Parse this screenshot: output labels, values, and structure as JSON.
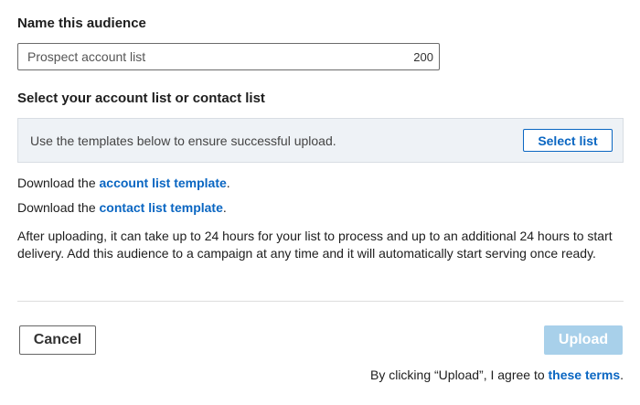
{
  "audience_name": {
    "label": "Name this audience",
    "value": "Prospect account list",
    "char_count": "200"
  },
  "list_selection": {
    "label": "Select your account list or contact list",
    "hint": "Use the templates below to ensure successful upload.",
    "select_button": "Select list"
  },
  "downloads": {
    "account": {
      "prefix": "Download the ",
      "link": "account list template",
      "suffix": "."
    },
    "contact": {
      "prefix": "Download the ",
      "link": "contact list template",
      "suffix": "."
    }
  },
  "info_text": "After uploading, it can take up to 24 hours for your list to process and up to an additional 24 hours to start delivery. Add this audience to a campaign at any time and it will automatically start serving once ready.",
  "actions": {
    "cancel": "Cancel",
    "upload": "Upload",
    "upload_enabled": false
  },
  "terms": {
    "prefix": "By clicking “Upload”, I agree to ",
    "link": "these terms",
    "suffix": "."
  },
  "colors": {
    "link": "#0a66c2",
    "upload_disabled_bg": "#a8d0ea",
    "template_box_bg": "#eef2f6"
  }
}
